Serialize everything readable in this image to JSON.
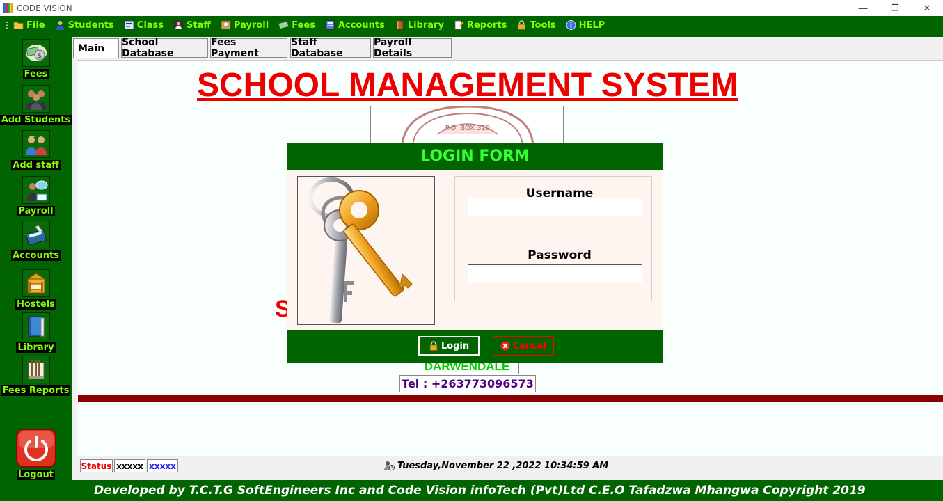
{
  "window": {
    "title": "CODE VISION",
    "minimize": "—",
    "restore": "❐",
    "close": "✕"
  },
  "menu": {
    "items": [
      {
        "label": "File",
        "icon": "folder-icon"
      },
      {
        "label": "Students",
        "icon": "student-icon"
      },
      {
        "label": "Class",
        "icon": "class-icon"
      },
      {
        "label": "Staff",
        "icon": "staff-icon"
      },
      {
        "label": "Payroll",
        "icon": "payroll-icon"
      },
      {
        "label": "Fees",
        "icon": "money-icon"
      },
      {
        "label": "Accounts",
        "icon": "calculator-icon"
      },
      {
        "label": "Library",
        "icon": "book-icon"
      },
      {
        "label": "Reports",
        "icon": "reports-icon"
      },
      {
        "label": "Tools",
        "icon": "lock-icon"
      },
      {
        "label": "HELP",
        "icon": "info-icon"
      }
    ]
  },
  "sidebar": {
    "items": [
      {
        "label": "Fees",
        "icon": "money-icon"
      },
      {
        "label": "Add Students",
        "icon": "students-group-icon"
      },
      {
        "label": "Add staff",
        "icon": "staff-group-icon"
      },
      {
        "label": "Payroll",
        "icon": "payroll-icon"
      },
      {
        "label": "Accounts",
        "icon": "calculator-icon"
      },
      {
        "label": "Hostels",
        "icon": "bed-icon"
      },
      {
        "label": "Library",
        "icon": "book-icon"
      },
      {
        "label": "Fees Reports",
        "icon": "reports-icon"
      },
      {
        "label": "Logout",
        "icon": "power-icon"
      }
    ]
  },
  "tabs": [
    {
      "label": "Main",
      "active": true
    },
    {
      "label": "School Database"
    },
    {
      "label": "Fees Payment"
    },
    {
      "label": "Staff Database"
    },
    {
      "label": "Payroll Details"
    }
  ],
  "main": {
    "title": "SCHOOL MANAGEMENT SYSTEM",
    "logo_text": "P.O. BOX 320",
    "partial_letter": "S",
    "school_name": "DARWENDALE",
    "tel": "Tel : +263773096573"
  },
  "status": {
    "label": "Status",
    "box1": "xxxxx",
    "box2": "xxxxx",
    "datetime": "Tuesday,November 22 ,2022  10:34:59 AM"
  },
  "footer": {
    "text": "Developed by T.C.T.G SoftEngineers Inc and Code Vision infoTech (Pvt)Ltd C.E.O Tafadzwa Mhangwa Copyright 2019"
  },
  "login": {
    "title": "LOGIN FORM",
    "username_label": "Username",
    "username_value": "",
    "password_label": "Password",
    "password_value": "",
    "login_button": "Login",
    "cancel_button": "Cancel"
  },
  "colors": {
    "menu_bg": "#006400",
    "menu_text": "#7fff00",
    "title_red": "#ee0000",
    "maroon": "#8b0000"
  }
}
